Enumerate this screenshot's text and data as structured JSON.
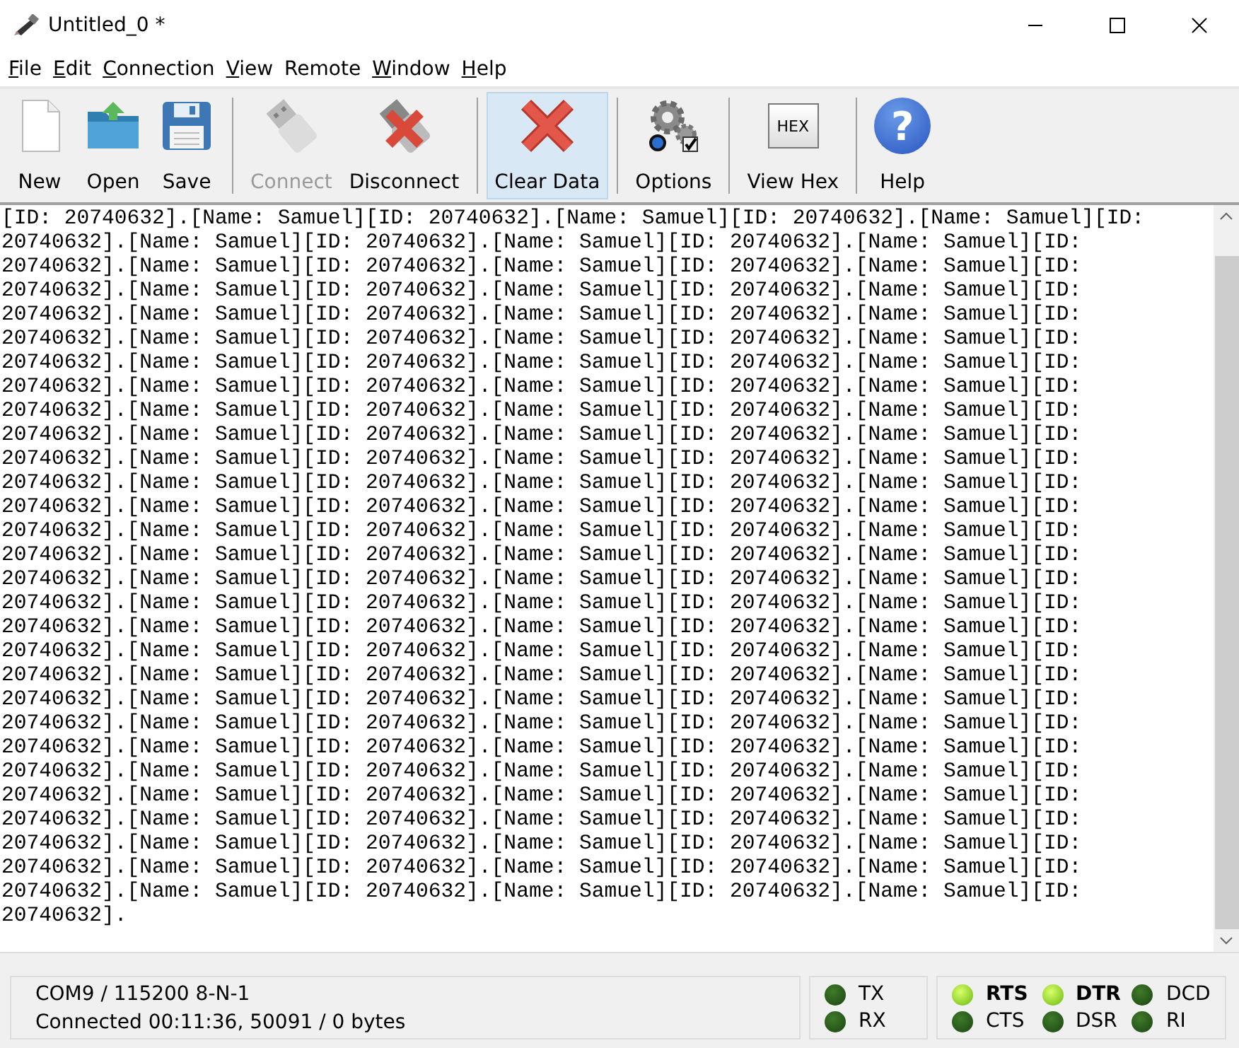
{
  "window": {
    "title": "Untitled_0 *"
  },
  "menu": [
    {
      "label": "File",
      "access_key_underlined": true
    },
    {
      "label": "Edit",
      "access_key_underlined": true
    },
    {
      "label": "Connection",
      "access_key_underlined": true
    },
    {
      "label": "View",
      "access_key_underlined": true
    },
    {
      "label": "Remote",
      "access_key_underlined": false
    },
    {
      "label": "Window",
      "access_key_underlined": true
    },
    {
      "label": "Help",
      "access_key_underlined": true
    }
  ],
  "toolbar": [
    {
      "kind": "new",
      "label": "New",
      "disabled": false,
      "selected": false
    },
    {
      "kind": "open",
      "label": "Open",
      "disabled": false,
      "selected": false
    },
    {
      "kind": "save",
      "label": "Save",
      "disabled": false,
      "selected": false
    },
    {
      "kind": "separator"
    },
    {
      "kind": "connect",
      "label": "Connect",
      "disabled": true,
      "selected": false
    },
    {
      "kind": "disconnect",
      "label": "Disconnect",
      "disabled": false,
      "selected": false
    },
    {
      "kind": "separator"
    },
    {
      "kind": "clear",
      "label": "Clear Data",
      "disabled": false,
      "selected": true
    },
    {
      "kind": "separator"
    },
    {
      "kind": "options",
      "label": "Options",
      "disabled": false,
      "selected": false
    },
    {
      "kind": "separator"
    },
    {
      "kind": "hex",
      "label": "View Hex",
      "icon_text": "HEX",
      "disabled": false,
      "selected": false
    },
    {
      "kind": "separator"
    },
    {
      "kind": "help",
      "label": "Help",
      "icon_text": "?",
      "disabled": false,
      "selected": false
    }
  ],
  "terminal": {
    "lines": [
      "[ID: 20740632].[Name: Samuel][ID: 20740632].[Name: Samuel][ID: 20740632].[Name: Samuel][ID:",
      "20740632].[Name: Samuel][ID: 20740632].[Name: Samuel][ID: 20740632].[Name: Samuel][ID:",
      "20740632].[Name: Samuel][ID: 20740632].[Name: Samuel][ID: 20740632].[Name: Samuel][ID:",
      "20740632].[Name: Samuel][ID: 20740632].[Name: Samuel][ID: 20740632].[Name: Samuel][ID:",
      "20740632].[Name: Samuel][ID: 20740632].[Name: Samuel][ID: 20740632].[Name: Samuel][ID:",
      "20740632].[Name: Samuel][ID: 20740632].[Name: Samuel][ID: 20740632].[Name: Samuel][ID:",
      "20740632].[Name: Samuel][ID: 20740632].[Name: Samuel][ID: 20740632].[Name: Samuel][ID:",
      "20740632].[Name: Samuel][ID: 20740632].[Name: Samuel][ID: 20740632].[Name: Samuel][ID:",
      "20740632].[Name: Samuel][ID: 20740632].[Name: Samuel][ID: 20740632].[Name: Samuel][ID:",
      "20740632].[Name: Samuel][ID: 20740632].[Name: Samuel][ID: 20740632].[Name: Samuel][ID:",
      "20740632].[Name: Samuel][ID: 20740632].[Name: Samuel][ID: 20740632].[Name: Samuel][ID:",
      "20740632].[Name: Samuel][ID: 20740632].[Name: Samuel][ID: 20740632].[Name: Samuel][ID:",
      "20740632].[Name: Samuel][ID: 20740632].[Name: Samuel][ID: 20740632].[Name: Samuel][ID:",
      "20740632].[Name: Samuel][ID: 20740632].[Name: Samuel][ID: 20740632].[Name: Samuel][ID:",
      "20740632].[Name: Samuel][ID: 20740632].[Name: Samuel][ID: 20740632].[Name: Samuel][ID:",
      "20740632].[Name: Samuel][ID: 20740632].[Name: Samuel][ID: 20740632].[Name: Samuel][ID:",
      "20740632].[Name: Samuel][ID: 20740632].[Name: Samuel][ID: 20740632].[Name: Samuel][ID:",
      "20740632].[Name: Samuel][ID: 20740632].[Name: Samuel][ID: 20740632].[Name: Samuel][ID:",
      "20740632].[Name: Samuel][ID: 20740632].[Name: Samuel][ID: 20740632].[Name: Samuel][ID:",
      "20740632].[Name: Samuel][ID: 20740632].[Name: Samuel][ID: 20740632].[Name: Samuel][ID:",
      "20740632].[Name: Samuel][ID: 20740632].[Name: Samuel][ID: 20740632].[Name: Samuel][ID:",
      "20740632].[Name: Samuel][ID: 20740632].[Name: Samuel][ID: 20740632].[Name: Samuel][ID:",
      "20740632].[Name: Samuel][ID: 20740632].[Name: Samuel][ID: 20740632].[Name: Samuel][ID:",
      "20740632].[Name: Samuel][ID: 20740632].[Name: Samuel][ID: 20740632].[Name: Samuel][ID:",
      "20740632].[Name: Samuel][ID: 20740632].[Name: Samuel][ID: 20740632].[Name: Samuel][ID:",
      "20740632].[Name: Samuel][ID: 20740632].[Name: Samuel][ID: 20740632].[Name: Samuel][ID:",
      "20740632].[Name: Samuel][ID: 20740632].[Name: Samuel][ID: 20740632].[Name: Samuel][ID:",
      "20740632].[Name: Samuel][ID: 20740632].[Name: Samuel][ID: 20740632].[Name: Samuel][ID:",
      "20740632].[Name: Samuel][ID: 20740632].[Name: Samuel][ID: 20740632].[Name: Samuel][ID:",
      "20740632]."
    ]
  },
  "status_bar": {
    "port": "COM9 / 115200 8-N-1",
    "connection": "Connected 00:11:36, 50091 / 0 bytes",
    "data_leds": [
      {
        "label": "TX",
        "on": false
      },
      {
        "label": "RX",
        "on": false
      }
    ],
    "line_leds": [
      {
        "label": "RTS",
        "on": true
      },
      {
        "label": "DTR",
        "on": true
      },
      {
        "label": "DCD",
        "on": false
      },
      {
        "label": "CTS",
        "on": false
      },
      {
        "label": "DSR",
        "on": false
      },
      {
        "label": "RI",
        "on": false
      }
    ]
  }
}
